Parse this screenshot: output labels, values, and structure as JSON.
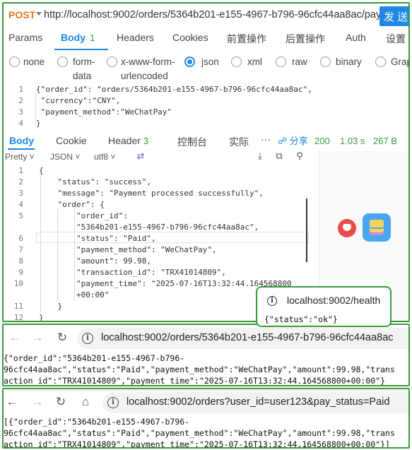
{
  "api_client": {
    "method": "POST",
    "url": "http://localhost:9002/orders/5364b201-e155-4967-b796-96cfc44aa8ac/pay",
    "send_label": "发 送",
    "request_tabs": [
      {
        "label": "Params"
      },
      {
        "label": "Body",
        "count": "1",
        "active": true
      },
      {
        "label": "Headers"
      },
      {
        "label": "Cookies"
      },
      {
        "label": "前置操作"
      },
      {
        "label": "后置操作"
      },
      {
        "label": "Auth"
      },
      {
        "label": "设置"
      }
    ],
    "body_types": {
      "none": "none",
      "form_data_1": "form-",
      "form_data_2": "data",
      "urlenc_1": "x-www-form-",
      "urlenc_2": "urlencoded",
      "json": "json",
      "xml": "xml",
      "raw": "raw",
      "binary": "binary",
      "graphql": "Grap",
      "selected": "json"
    },
    "request_body_lines": [
      {
        "n": "1",
        "text": "{\"order_id\": \"orders/5364b201-e155-4967-b796-96cfc44aa8ac\","
      },
      {
        "n": "2",
        "text": " \"currency\":\"CNY\","
      },
      {
        "n": "3",
        "text": " \"payment_method\":\"WeChatPay\""
      },
      {
        "n": "4",
        "text": "}"
      }
    ],
    "response_tabs": [
      {
        "label": "Body",
        "active": true
      },
      {
        "label": "Cookie"
      },
      {
        "label": "Header",
        "count": "3"
      },
      {
        "label": "控制台"
      },
      {
        "label": "实际"
      }
    ],
    "more": "···",
    "share": "分享",
    "status_code": "200",
    "time": "1.03 s",
    "size": "267 B",
    "view_mode": "Pretty",
    "format": "JSON",
    "encoding": "utf8",
    "response_lines": [
      {
        "n": "1",
        "text": "{"
      },
      {
        "n": "2",
        "text": "    \"status\": \"success\","
      },
      {
        "n": "3",
        "text": "    \"message\": \"Payment processed successfully\","
      },
      {
        "n": "4",
        "text": "    \"order\": {"
      },
      {
        "n": "5",
        "text": "        \"order_id\":"
      },
      {
        "n": "",
        "text": "        \"5364b201-e155-4967-b796-96cfc44aa8ac\","
      },
      {
        "n": "6",
        "text": "        \"status\": \"Paid\","
      },
      {
        "n": "7",
        "text": "        \"payment_method\": \"WeChatPay\","
      },
      {
        "n": "8",
        "text": "        \"amount\": 99.98,"
      },
      {
        "n": "9",
        "text": "        \"transaction_id\": \"TRX41014809\","
      },
      {
        "n": "10",
        "text": "        \"payment_time\": \"2025-07-16T13:32:44.164568800"
      },
      {
        "n": "",
        "text": "        +00:00\""
      },
      {
        "n": "11",
        "text": "    }"
      },
      {
        "n": "12",
        "text": "}"
      }
    ]
  },
  "health_popup": {
    "url": "localhost:9002/health",
    "body": "{\"status\":\"ok\"}"
  },
  "browser_1": {
    "address": "localhost:9002/orders/5364b201-e155-4967-b796-96cfc44aa8ac",
    "lines": [
      "{\"order_id\":\"5364b201-e155-4967-b796-",
      "96cfc44aa8ac\",\"status\":\"Paid\",\"payment_method\":\"WeChatPay\",\"amount\":99.98,\"trans",
      "action_id\":\"TRX41014809\",\"payment_time\":\"2025-07-16T13:32:44.164568800+00:00\"}"
    ]
  },
  "browser_2": {
    "address": "localhost:9002/orders?user_id=user123&pay_status=Paid",
    "lines": [
      "[{\"order_id\":\"5364b201-e155-4967-b796-",
      "96cfc44aa8ac\",\"status\":\"Paid\",\"payment_method\":\"WeChatPay\",\"amount\":99.98,\"trans",
      "action_id\":\"TRX41014809\",\"payment_time\":\"2025-07-16T13:32:44.164568800+00:00\"}]"
    ]
  },
  "icons": {
    "back": "arrow-left-icon",
    "forward": "arrow-right-icon",
    "reload": "reload-icon",
    "home": "home-icon",
    "info": "info-icon",
    "download": "download-icon",
    "copy": "copy-icon",
    "search": "search-icon",
    "wrap": "wrap-icon",
    "share": "share-icon"
  },
  "colors": {
    "accent": "#1e88e5",
    "method": "#e8791c",
    "success": "#3a9a3a"
  }
}
